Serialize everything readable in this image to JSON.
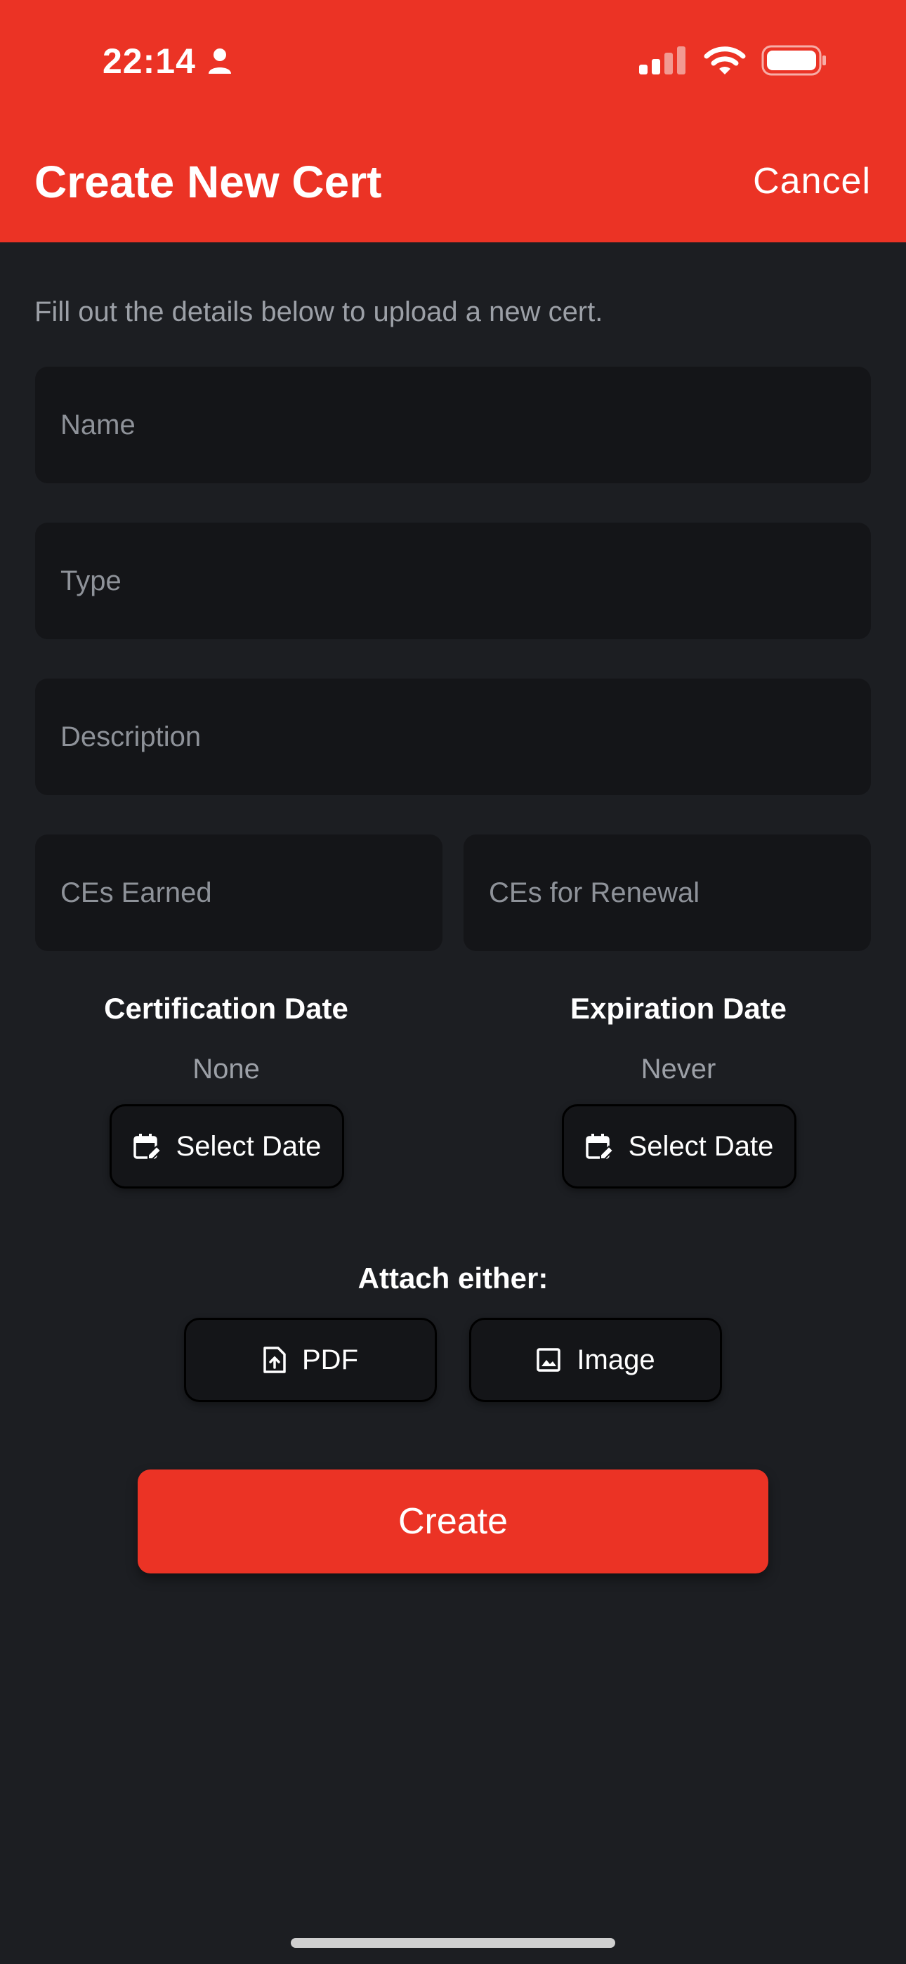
{
  "status_bar": {
    "time": "22:14"
  },
  "header": {
    "title": "Create New Cert",
    "cancel_label": "Cancel"
  },
  "intro": "Fill out the details below to upload a new cert.",
  "fields": {
    "name_placeholder": "Name",
    "type_placeholder": "Type",
    "description_placeholder": "Description",
    "ces_earned_placeholder": "CEs Earned",
    "ces_renewal_placeholder": "CEs for Renewal"
  },
  "dates": {
    "certification": {
      "title": "Certification Date",
      "value": "None",
      "button": "Select Date"
    },
    "expiration": {
      "title": "Expiration Date",
      "value": "Never",
      "button": "Select Date"
    }
  },
  "attach": {
    "label": "Attach either:",
    "pdf": "PDF",
    "image": "Image"
  },
  "create_label": "Create",
  "colors": {
    "accent": "#eb3325",
    "background": "#1c1e22",
    "field": "#141518"
  }
}
